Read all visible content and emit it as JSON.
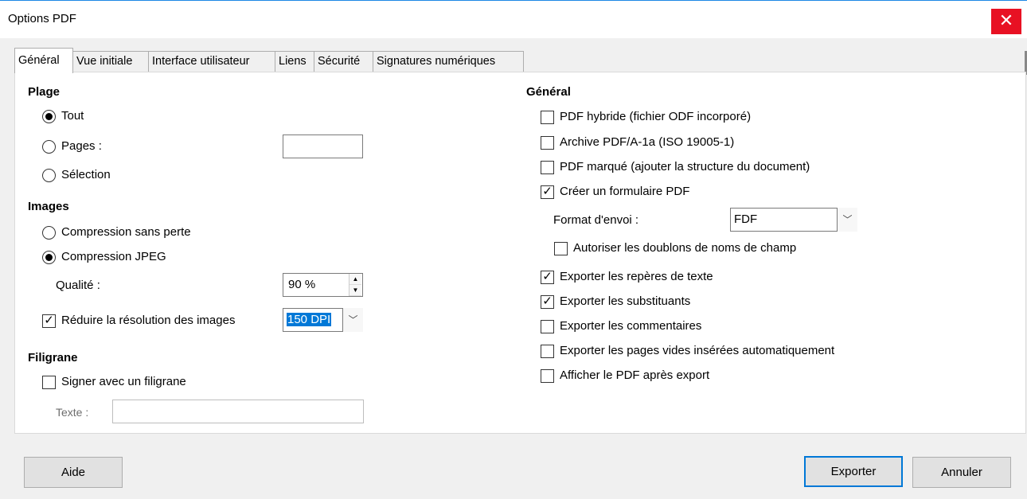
{
  "window": {
    "title": "Options PDF",
    "close_glyph": "✕"
  },
  "tabs": [
    {
      "label": "Général",
      "active": true
    },
    {
      "label": "Vue initiale"
    },
    {
      "label": "Interface utilisateur"
    },
    {
      "label": "Liens"
    },
    {
      "label": "Sécurité"
    },
    {
      "label": "Signatures numériques"
    }
  ],
  "plage": {
    "heading": "Plage",
    "tout": "Tout",
    "pages": "Pages :",
    "pages_value": "",
    "selection": "Sélection",
    "selected": "tout"
  },
  "images": {
    "heading": "Images",
    "lossless": "Compression sans perte",
    "jpeg": "Compression JPEG",
    "selected": "jpeg",
    "quality_label": "Qualité :",
    "quality_value": "90 %",
    "reduce_label": "Réduire la résolution des images",
    "reduce_checked": true,
    "dpi_value": "150 DPI"
  },
  "filigrane": {
    "heading": "Filigrane",
    "sign_label": "Signer avec un filigrane",
    "sign_checked": false,
    "text_label": "Texte :",
    "text_value": ""
  },
  "general": {
    "heading": "Général",
    "options": [
      {
        "label": "PDF hybride (fichier ODF incorporé)",
        "checked": false
      },
      {
        "label": "Archive PDF/A-1a (ISO 19005-1)",
        "checked": false
      },
      {
        "label": "PDF marqué (ajouter la structure du document)",
        "checked": false
      },
      {
        "label": "Créer un formulaire PDF",
        "checked": true
      }
    ],
    "format_label": "Format d'envoi :",
    "format_value": "FDF",
    "duplicates_label": "Autoriser les doublons de noms de champ",
    "duplicates_checked": false,
    "options2": [
      {
        "label": "Exporter les repères de texte",
        "checked": true
      },
      {
        "label": "Exporter les substituants",
        "checked": true
      },
      {
        "label": "Exporter les commentaires",
        "checked": false
      },
      {
        "label": "Exporter les pages vides insérées automatiquement",
        "checked": false
      },
      {
        "label": "Afficher le PDF après export",
        "checked": false
      }
    ]
  },
  "buttons": {
    "help": "Aide",
    "export": "Exporter",
    "cancel": "Annuler"
  },
  "colors": {
    "close_bg": "#e81123",
    "accent": "#0078d7",
    "title_border": "#1e88e5"
  }
}
